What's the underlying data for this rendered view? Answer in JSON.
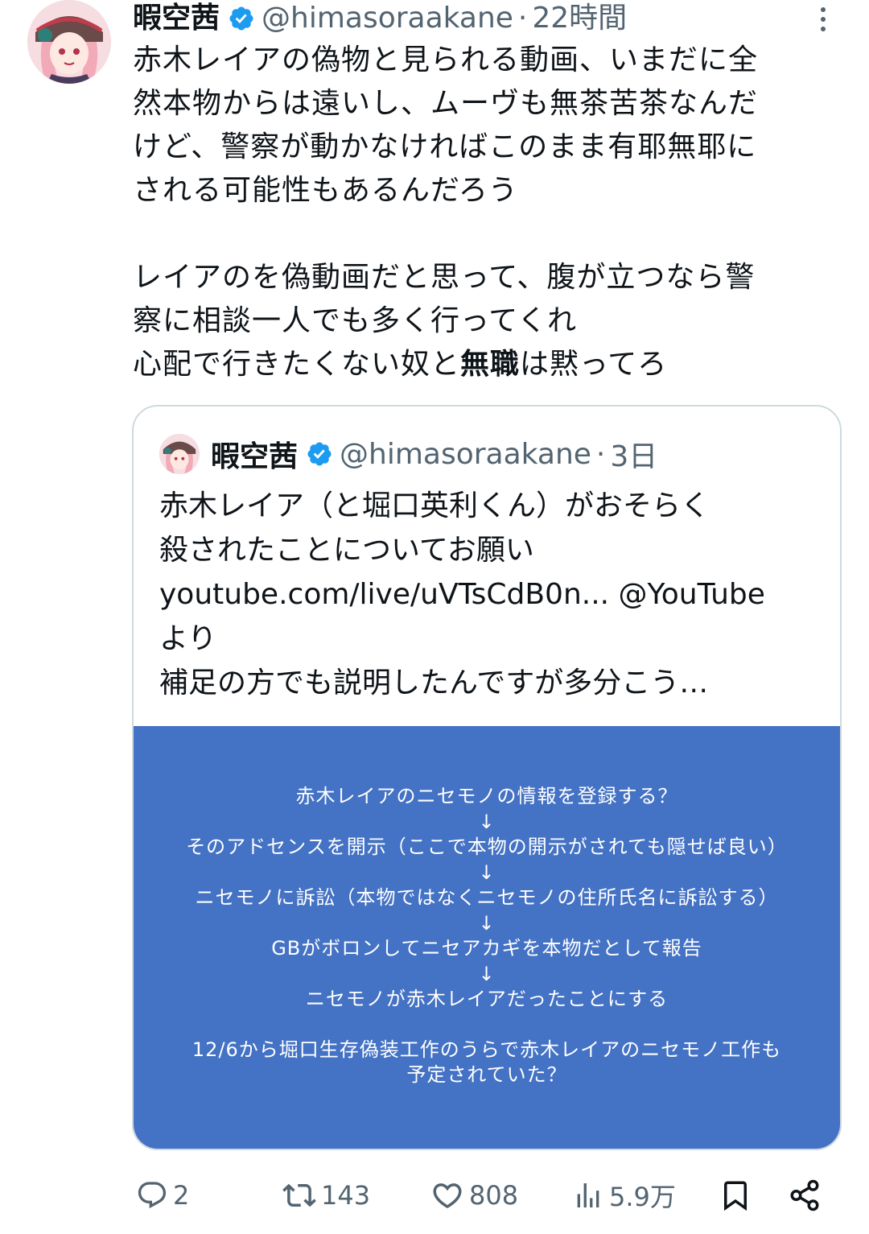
{
  "tweet": {
    "name": "暇空茜",
    "handle": "@himasoraakane",
    "separator": "·",
    "time": "22時間",
    "lines_p1": "赤木レイアの偽物と見られる動画、いまだに全\n然本物からは遠いし、ムーヴも無茶苦茶なんだ\nけど、警察が動かなければこのまま有耶無耶に\nされる可能性もあるんだろう",
    "lines_p2": "レイアのを偽動画だと思って、腹が立つなら警\n察に相談一人でも多く行ってくれ",
    "line_p3_before": "心配で行きたくない奴と",
    "line_p3_bold": "無職",
    "line_p3_after": "は黙ってろ"
  },
  "quote": {
    "name": "暇空茜",
    "handle": "@himasoraakane",
    "separator": "·",
    "time": "3日",
    "line1": "赤木レイア（と堀口英利くん）がおそらく",
    "line2": "殺されたことについてお願い",
    "line3_link": "youtube.com/live/uVTsCdB0n...",
    "line3_rest": " @YouTube",
    "line4": "より",
    "line5": "補足の方でも説明したんですが多分こう…",
    "image": {
      "bg_color": "#4472c4",
      "step1": "赤木レイアのニセモノの情報を登録する？",
      "step2": "そのアドセンスを開示（ここで本物の開示がされても隠せば良い）",
      "step3": "ニセモノに訴訟（本物ではなくニセモノの住所氏名に訴訟する）",
      "step4": "GBがボロンしてニセアカギを本物だとして報告",
      "step5": "ニセモノが赤木レイアだったことにする",
      "arrow": "↓",
      "note1": "12/6から堀口生存偽装工作のうらで赤木レイアのニセモノ工作も",
      "note2": "予定されていた？"
    }
  },
  "actions": {
    "reply_count": "2",
    "retweet_count": "143",
    "like_count": "808",
    "views_count": "5.9万"
  },
  "colors": {
    "verified": "#1d9bf0",
    "secondary_text": "#536471",
    "border": "#cfd9de"
  },
  "icons": [
    "more-vertical-icon",
    "verified-badge-icon",
    "reply-icon",
    "retweet-icon",
    "like-icon",
    "views-icon",
    "bookmark-icon",
    "share-icon"
  ]
}
